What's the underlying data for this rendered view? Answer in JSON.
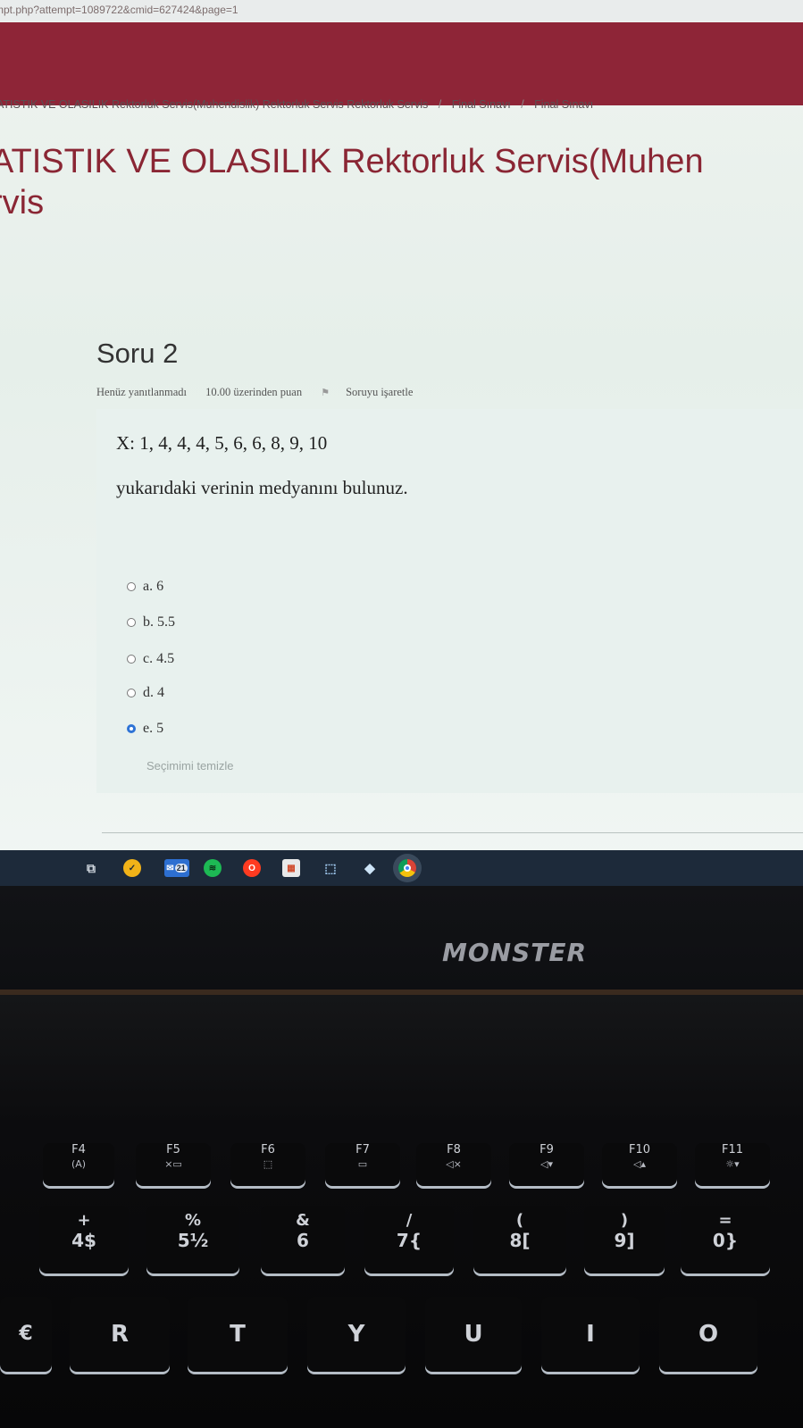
{
  "browser": {
    "url": "mpt.php?attempt=1089722&cmid=627424&page=1"
  },
  "breadcrumb": {
    "items": [
      "ATISTIK VE OLASILIK Rektorluk Servis(Muhendislik) Rektorluk Servis Rektorluk Servis",
      "Final Sınavı",
      "Final Sınavı"
    ],
    "separator": "/"
  },
  "course": {
    "title_line1": "ATISTIK VE OLASILIK Rektorluk Servis(Muhen",
    "title_line2": "rvis"
  },
  "question": {
    "number_label": "Soru 2",
    "status": "Henüz yanıtlanmadı",
    "points": "10.00 üzerinden puan",
    "flag_label": "Soruyu işaretle",
    "text_line1": "X: 1, 4, 4, 4, 5, 6, 6, 8, 9, 10",
    "text_line2": "yukarıdaki verinin medyanını bulunuz.",
    "options": [
      {
        "label": "a. 6",
        "checked": false
      },
      {
        "label": "b. 5.5",
        "checked": false
      },
      {
        "label": "c. 4.5",
        "checked": false
      },
      {
        "label": "d. 4",
        "checked": false
      },
      {
        "label": "e. 5",
        "checked": true
      }
    ],
    "clear_choice": "Seçimimi temizle"
  },
  "taskbar": {
    "mail_badge": "21",
    "icons": [
      "task-view-icon",
      "norton-icon",
      "mail-icon",
      "spotify-icon",
      "opera-icon",
      "store-icon",
      "network-icon",
      "cube-icon",
      "chrome-icon"
    ]
  },
  "laptop": {
    "brand": "MONSTER",
    "fkeys": [
      {
        "label": "F4",
        "sub": "(A)"
      },
      {
        "label": "F5",
        "sub": "×▭"
      },
      {
        "label": "F6",
        "sub": "⬚"
      },
      {
        "label": "F7",
        "sub": "▭"
      },
      {
        "label": "F8",
        "sub": "◁×"
      },
      {
        "label": "F9",
        "sub": "◁▾"
      },
      {
        "label": "F10",
        "sub": "◁▴"
      },
      {
        "label": "F11",
        "sub": "☼▾"
      }
    ],
    "numkeys": [
      {
        "top": "+",
        "main": "4$"
      },
      {
        "top": "%",
        "main": "5½"
      },
      {
        "top": "&",
        "main": "6"
      },
      {
        "top": "/",
        "main": "7{"
      },
      {
        "top": "(",
        "main": "8["
      },
      {
        "top": ")",
        "main": "9]"
      },
      {
        "top": "=",
        "main": "0}"
      }
    ],
    "letterkeys": [
      "R",
      "T",
      "Y",
      "U",
      "I",
      "O"
    ],
    "edge_key": "€"
  }
}
